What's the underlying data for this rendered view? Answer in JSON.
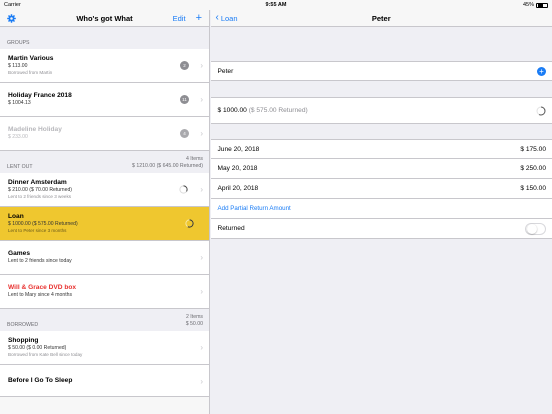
{
  "status_bar": {
    "carrier": "Carrier",
    "time": "9:55 AM",
    "battery": "45%"
  },
  "master": {
    "title": "Who's got What",
    "edit_label": "Edit",
    "add_label": "+",
    "sections": {
      "groups": {
        "header": "GROUPS"
      },
      "lent": {
        "header": "LENT OUT",
        "count": "4 Items",
        "total": "$ 1210.00 ($ 645.00 Returned)"
      },
      "borrowed": {
        "header": "BORROWED",
        "count": "2 Items",
        "total": "$ 50.00"
      }
    },
    "groups": [
      {
        "title": "Martin Various",
        "amount": "$ 113.00",
        "note": "Borrowed from Martin",
        "badge": "2"
      },
      {
        "title": "Holiday France 2018",
        "amount": "$ 1004.13",
        "note": "",
        "badge": "11"
      },
      {
        "title": "Madeline Holiday",
        "amount": "$ 233.00",
        "note": "",
        "badge": "4"
      }
    ],
    "lent": [
      {
        "title": "Dinner Amsterdam",
        "amount": "$ 210.00 ($ 70.00 Returned)",
        "note": "Lent to 2 friends since 3 weeks"
      },
      {
        "title": "Loan",
        "amount": "$ 1000.00 ($ 575.00 Returned)",
        "note": "Lent to Peter since 3 months"
      },
      {
        "title": "Games",
        "note": "Lent to 2 friends since today"
      },
      {
        "title": "Will & Grace DVD box",
        "note": "Lent to Mary since 4 months"
      }
    ],
    "borrowed": [
      {
        "title": "Shopping",
        "amount": "$ 50.00 ($ 0.00 Returned)",
        "note": "Borrowed from Kate Bell since today"
      },
      {
        "title": "Before I Go To Sleep"
      }
    ]
  },
  "detail": {
    "back_label": "Loan",
    "title": "Peter",
    "person": "Peter",
    "amount": "$ 1000.00",
    "returned_amount": "($ 575.00 Returned)",
    "returned_fraction": 0.575,
    "returns": [
      {
        "date": "June 20, 2018",
        "amount": "$ 175.00"
      },
      {
        "date": "May 20, 2018",
        "amount": "$ 250.00"
      },
      {
        "date": "April 20, 2018",
        "amount": "$ 150.00"
      }
    ],
    "add_partial_label": "Add Partial Return Amount",
    "returned_label": "Returned",
    "returned_on": false
  },
  "colors": {
    "accent": "#1a7cf5",
    "selected": "#efc72f",
    "warning": "#e8312f"
  },
  "icons": {
    "settings": "gear-icon",
    "add": "plus-icon",
    "back": "chevron-left-icon",
    "disclosure": "chevron-right-icon"
  }
}
